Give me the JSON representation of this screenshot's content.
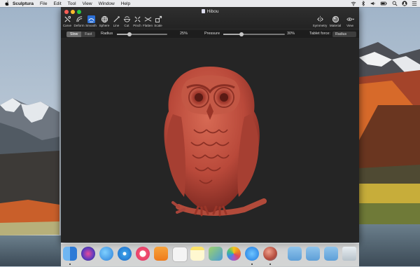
{
  "menubar": {
    "app_name": "Sculptura",
    "items": [
      "File",
      "Edit",
      "Tool",
      "View",
      "Window",
      "Help"
    ],
    "status_icons": [
      "wifi-icon",
      "bluetooth-icon",
      "volume-icon",
      "battery-icon",
      "spotlight-icon",
      "user-icon",
      "menu-list-icon"
    ]
  },
  "window": {
    "title": "Hibou",
    "tools": [
      {
        "label": "Carve",
        "icon": "carve-icon"
      },
      {
        "label": "Deform",
        "icon": "deform-icon"
      },
      {
        "label": "Smooth",
        "icon": "smooth-icon"
      },
      {
        "label": "Sphere",
        "icon": "sphere-icon"
      },
      {
        "label": "Line",
        "icon": "line-icon"
      },
      {
        "label": "Cut",
        "icon": "cut-icon"
      },
      {
        "label": "Pinch",
        "icon": "pinch-icon"
      },
      {
        "label": "Flatten",
        "icon": "flatten-icon"
      },
      {
        "label": "Scale",
        "icon": "scale-icon"
      }
    ],
    "active_tool": "Smooth",
    "right_tools": [
      {
        "label": "Symmetry",
        "icon": "symmetry-icon"
      },
      {
        "label": "Material",
        "icon": "material-icon"
      },
      {
        "label": "View",
        "icon": "view-icon"
      }
    ]
  },
  "options": {
    "modes": [
      "Slow",
      "Fast"
    ],
    "selected_mode": "Slow",
    "radius_label": "Radius",
    "radius_value": "25%",
    "radius_fraction": 0.25,
    "pressure_label": "Pressure",
    "pressure_value": "30%",
    "pressure_fraction": 0.3,
    "tablet_force_label": "Tablet force:",
    "tablet_force_value": "Radius"
  },
  "viewport": {
    "model_name": "owl-sculpture",
    "model_color": "#c0523f"
  },
  "dock": {
    "icons": [
      "finder-icon",
      "siri-icon",
      "messages-icon",
      "safari-icon",
      "itunes-icon",
      "ibooks-icon",
      "textedit-icon",
      "notes-icon",
      "preview-icon",
      "photos-icon",
      "app-store-icon",
      "sculptura-icon",
      "applications-folder-icon",
      "documents-folder-icon",
      "downloads-folder-icon",
      "trash-icon"
    ]
  },
  "colors": {
    "window_bg": "#262626",
    "active_tool": "#2b6fd6",
    "close": "#fc5f57",
    "minimize": "#fdbc2e",
    "zoom": "#28c840"
  }
}
